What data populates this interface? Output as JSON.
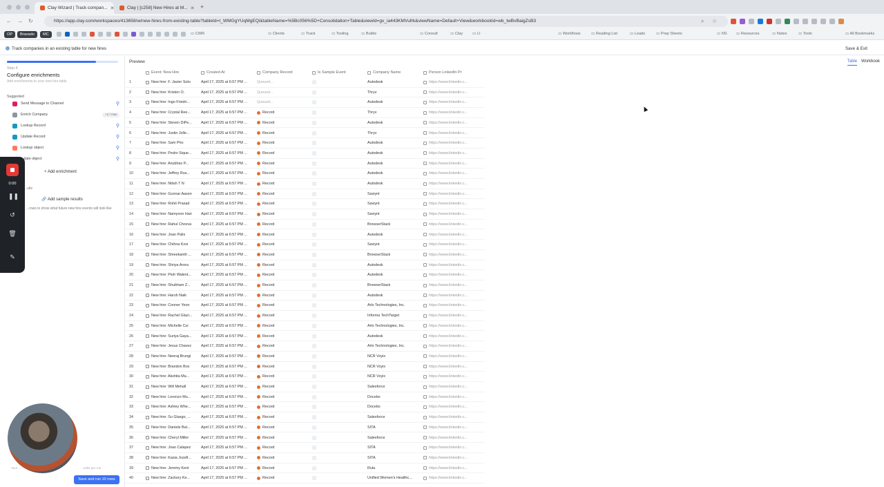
{
  "browser": {
    "tabs": [
      {
        "title": "Clay Wizard | Track compan...",
        "active": true
      },
      {
        "title": "Clay | [c258] New Hires at M...",
        "active": false
      }
    ],
    "url": "https://app.clay.com/workspaces/413658/w/new-hires-from-existing-table?tableId=t_WMGgYUqMgEQi&tableName=%5Bc056%5D+Consolidation+Table&viewId=gv_ia443KMVufrk&viewName=Default+View&workbookId=wb_twBvBaigZsB3",
    "bookmarks": [
      {
        "kind": "chip",
        "label": "OP"
      },
      {
        "kind": "chip",
        "label": "Bravado"
      },
      {
        "kind": "chip",
        "label": "MC"
      },
      {
        "kind": "folder",
        "label": "CWR"
      },
      {
        "kind": "folder",
        "label": "Clients"
      },
      {
        "kind": "folder",
        "label": "Track"
      },
      {
        "kind": "folder",
        "label": "Tooling"
      },
      {
        "kind": "folder",
        "label": "Builds"
      },
      {
        "kind": "folder",
        "label": "Consult"
      },
      {
        "kind": "folder",
        "label": "Clay"
      },
      {
        "kind": "folder",
        "label": "LI"
      },
      {
        "kind": "folder",
        "label": "Workflows"
      },
      {
        "kind": "folder",
        "label": "Reading List"
      },
      {
        "kind": "folder",
        "label": "Leads"
      },
      {
        "kind": "folder",
        "label": "Prep Sheets"
      },
      {
        "kind": "folder",
        "label": "NS"
      },
      {
        "kind": "folder",
        "label": "Resources"
      },
      {
        "kind": "folder",
        "label": "Notes"
      },
      {
        "kind": "folder",
        "label": "Tools"
      },
      {
        "kind": "folder",
        "label": "All Bookmarks"
      }
    ]
  },
  "app": {
    "title": "Track companies in an existing table for new hires",
    "save_exit": "Save & Exit"
  },
  "sidebar": {
    "progress_fraction": 0.8,
    "step": "Step 4",
    "heading": "Configure enrichments",
    "subheading": "Add enrichments to your new hire table",
    "suggested_label": "Suggested",
    "enrichments": [
      {
        "label": "Send Message to Channel",
        "icon": "slack-icon",
        "color": "#e01e5a",
        "extra": "pin"
      },
      {
        "label": "Enrich Company",
        "icon": "building-icon",
        "color": "#8c96a3",
        "extra": "badge",
        "badge": "~1 / row"
      },
      {
        "label": "Lookup Record",
        "icon": "salesforce-icon",
        "color": "#1798c1",
        "extra": "pin"
      },
      {
        "label": "Update Record",
        "icon": "salesforce-icon",
        "color": "#1798c1",
        "extra": "pin"
      },
      {
        "label": "Lookup object",
        "icon": "hubspot-icon",
        "color": "#ff7a59",
        "extra": "pin"
      },
      {
        "label": "...date object",
        "icon": "hubspot-icon",
        "color": "#ff7a59",
        "extra": "pin"
      }
    ],
    "add_enrichment": "+ Add enrichment",
    "results_label": "...ults",
    "add_sample": "Add sample results",
    "sample_hint": "...rows to show what future new hire events will look like",
    "footnote_left": "Your ...",
    "footnote_right": "...edits per run",
    "run_button": "Save and run 10 rows"
  },
  "recorder": {
    "time": "0:00"
  },
  "main": {
    "preview_label": "Preview",
    "view_tabs": {
      "table": "Table",
      "workbook": "Workbook"
    },
    "columns": {
      "event": "Event: New Hire",
      "created": "Created At",
      "record": "Company Record",
      "sample": "Is Sample Event",
      "company": "Company Name",
      "linkedin": "Person LinkedIn Pr"
    },
    "rows": [
      {
        "n": "1",
        "ev": "New hire: F. Javier Soto",
        "ct": "April 17, 2025 at 6:57 PM ...",
        "cr": "Queued...",
        "q": true,
        "cn": "Autodesk",
        "li": "https://www.linkedin.c..."
      },
      {
        "n": "2",
        "ev": "New hire: Kristen O.",
        "ct": "April 17, 2025 at 6:57 PM ...",
        "cr": "Queued...",
        "q": true,
        "cn": "Thryv",
        "li": "https://www.linkedin.c..."
      },
      {
        "n": "3",
        "ev": "New hire: Ingo Friedri...",
        "ct": "April 17, 2025 at 6:57 PM ...",
        "cr": "Queued...",
        "q": true,
        "cn": "Autodesk",
        "li": "https://www.linkedin.c..."
      },
      {
        "n": "4",
        "ev": "New hire: Crystal Ree...",
        "ct": "April 17, 2025 at 6:57 PM ...",
        "cr": "Record",
        "q": false,
        "cn": "Thryv",
        "li": "https://www.linkedin.c..."
      },
      {
        "n": "5",
        "ev": "New hire: Steven DiPe...",
        "ct": "April 17, 2025 at 6:57 PM ...",
        "cr": "Record",
        "q": false,
        "cn": "Autodesk",
        "li": "https://www.linkedin.c..."
      },
      {
        "n": "6",
        "ev": "New hire: Justin Jolle...",
        "ct": "April 17, 2025 at 6:57 PM ...",
        "cr": "Record",
        "q": false,
        "cn": "Thryv",
        "li": "https://www.linkedin.c..."
      },
      {
        "n": "7",
        "ev": "New hire: Sam Pho",
        "ct": "April 17, 2025 at 6:57 PM ...",
        "cr": "Record",
        "q": false,
        "cn": "Autodesk",
        "li": "https://www.linkedin.c..."
      },
      {
        "n": "8",
        "ev": "New hire: Pedro Sique...",
        "ct": "April 17, 2025 at 6:57 PM ...",
        "cr": "Record",
        "q": false,
        "cn": "Autodesk",
        "li": "https://www.linkedin.c..."
      },
      {
        "n": "9",
        "ev": "New hire: Anubhav P...",
        "ct": "April 17, 2025 at 6:57 PM ...",
        "cr": "Record",
        "q": false,
        "cn": "Autodesk",
        "li": "https://www.linkedin.c..."
      },
      {
        "n": "10",
        "ev": "New hire: Jeffrey Rus...",
        "ct": "April 17, 2025 at 6:57 PM ...",
        "cr": "Record",
        "q": false,
        "cn": "Autodesk",
        "li": "https://www.linkedin.c..."
      },
      {
        "n": "11",
        "ev": "New hire: Nitish T N",
        "ct": "April 17, 2025 at 6:57 PM ...",
        "cr": "Record",
        "q": false,
        "cn": "Autodesk",
        "li": "https://www.linkedin.c..."
      },
      {
        "n": "12",
        "ev": "New hire: Gunnar Aasen",
        "ct": "April 17, 2025 at 6:57 PM ...",
        "cr": "Record",
        "q": false,
        "cn": "Saviynt",
        "li": "https://www.linkedin.c..."
      },
      {
        "n": "13",
        "ev": "New hire: Rohit Prasad",
        "ct": "April 17, 2025 at 6:57 PM ...",
        "cr": "Record",
        "q": false,
        "cn": "Saviynt",
        "li": "https://www.linkedin.c..."
      },
      {
        "n": "14",
        "ev": "New hire: Namyoon Han",
        "ct": "April 17, 2025 at 6:57 PM ...",
        "cr": "Record",
        "q": false,
        "cn": "Saviynt",
        "li": "https://www.linkedin.c..."
      },
      {
        "n": "15",
        "ev": "New hire: Rahul Chovva",
        "ct": "April 17, 2025 at 6:57 PM ...",
        "cr": "Record",
        "q": false,
        "cn": "BrowserStack",
        "li": "https://www.linkedin.c..."
      },
      {
        "n": "16",
        "ev": "New hire: Joan Palis",
        "ct": "April 17, 2025 at 6:57 PM ...",
        "cr": "Record",
        "q": false,
        "cn": "Autodesk",
        "li": "https://www.linkedin.c..."
      },
      {
        "n": "17",
        "ev": "New hire: Chihna Kovi",
        "ct": "April 17, 2025 at 6:57 PM ...",
        "cr": "Record",
        "q": false,
        "cn": "Saviynt",
        "li": "https://www.linkedin.c..."
      },
      {
        "n": "18",
        "ev": "New hire: Shreekanth ...",
        "ct": "April 17, 2025 at 6:57 PM ...",
        "cr": "Record",
        "q": false,
        "cn": "BrowserStack",
        "li": "https://www.linkedin.c..."
      },
      {
        "n": "19",
        "ev": "New hire: Shriya Arora",
        "ct": "April 17, 2025 at 6:57 PM ...",
        "cr": "Record",
        "q": false,
        "cn": "Autodesk",
        "li": "https://www.linkedin.c..."
      },
      {
        "n": "20",
        "ev": "New hire: Piotr Walent...",
        "ct": "April 17, 2025 at 6:57 PM ...",
        "cr": "Record",
        "q": false,
        "cn": "Autodesk",
        "li": "https://www.linkedin.c..."
      },
      {
        "n": "21",
        "ev": "New hire: Shubham Z...",
        "ct": "April 17, 2025 at 6:57 PM ...",
        "cr": "Record",
        "q": false,
        "cn": "BrowserStack",
        "li": "https://www.linkedin.c..."
      },
      {
        "n": "22",
        "ev": "New hire: Harsh Naik",
        "ct": "April 17, 2025 at 6:57 PM ...",
        "cr": "Record",
        "q": false,
        "cn": "Autodesk",
        "li": "https://www.linkedin.c..."
      },
      {
        "n": "23",
        "ev": "New hire: Conner Yeon",
        "ct": "April 17, 2025 at 6:57 PM ...",
        "cr": "Record",
        "q": false,
        "cn": "Arlo Technologies, Inc.",
        "li": "https://www.linkedin.c..."
      },
      {
        "n": "24",
        "ev": "New hire: Rachel Glazi...",
        "ct": "April 17, 2025 at 6:57 PM ...",
        "cr": "Record",
        "q": false,
        "cn": "Informa TechTarget",
        "li": "https://www.linkedin.c..."
      },
      {
        "n": "25",
        "ev": "New hire: Michelle Cui",
        "ct": "April 17, 2025 at 6:57 PM ...",
        "cr": "Record",
        "q": false,
        "cn": "Arlo Technologies, Inc.",
        "li": "https://www.linkedin.c..."
      },
      {
        "n": "26",
        "ev": "New hire: Suriya Gaya...",
        "ct": "April 17, 2025 at 6:57 PM ...",
        "cr": "Record",
        "q": false,
        "cn": "Autodesk",
        "li": "https://www.linkedin.c..."
      },
      {
        "n": "27",
        "ev": "New hire: Jesus Chavez",
        "ct": "April 17, 2025 at 6:57 PM ...",
        "cr": "Record",
        "q": false,
        "cn": "Arlo Technologies, Inc.",
        "li": "https://www.linkedin.c..."
      },
      {
        "n": "28",
        "ev": "New hire: Neeraj Brungi",
        "ct": "April 17, 2025 at 6:57 PM ...",
        "cr": "Record",
        "q": false,
        "cn": "NCR Voyix",
        "li": "https://www.linkedin.c..."
      },
      {
        "n": "29",
        "ev": "New hire: Brandon Box",
        "ct": "April 17, 2025 at 6:57 PM ...",
        "cr": "Record",
        "q": false,
        "cn": "NCR Voyix",
        "li": "https://www.linkedin.c..."
      },
      {
        "n": "30",
        "ev": "New hire: Akshita Ma...",
        "ct": "April 17, 2025 at 6:57 PM ...",
        "cr": "Record",
        "q": false,
        "cn": "NCR Voyix",
        "li": "https://www.linkedin.c..."
      },
      {
        "n": "31",
        "ev": "New hire: Will Mehall",
        "ct": "April 17, 2025 at 6:57 PM ...",
        "cr": "Record",
        "q": false,
        "cn": "Salesforce",
        "li": "https://www.linkedin.c..."
      },
      {
        "n": "32",
        "ev": "New hire: Lorenzo Mu...",
        "ct": "April 17, 2025 at 6:57 PM ...",
        "cr": "Record",
        "q": false,
        "cn": "Docebo",
        "li": "https://www.linkedin.c..."
      },
      {
        "n": "33",
        "ev": "New hire: Ashley Whe...",
        "ct": "April 17, 2025 at 6:57 PM ...",
        "cr": "Record",
        "q": false,
        "cn": "Docebo",
        "li": "https://www.linkedin.c..."
      },
      {
        "n": "34",
        "ev": "New hire: Su Glasgo, ...",
        "ct": "April 17, 2025 at 6:57 PM ...",
        "cr": "Record",
        "q": false,
        "cn": "Salesforce",
        "li": "https://www.linkedin.c..."
      },
      {
        "n": "35",
        "ev": "New hire: Daniele Bal...",
        "ct": "April 17, 2025 at 6:57 PM ...",
        "cr": "Record",
        "q": false,
        "cn": "SITA",
        "li": "https://www.linkedin.c..."
      },
      {
        "n": "36",
        "ev": "New hire: Cheryl Miller",
        "ct": "April 17, 2025 at 6:57 PM ...",
        "cr": "Record",
        "q": false,
        "cn": "Salesforce",
        "li": "https://www.linkedin.c..."
      },
      {
        "n": "37",
        "ev": "New hire: Joao Calapez",
        "ct": "April 17, 2025 at 6:57 PM ...",
        "cr": "Record",
        "q": false,
        "cn": "SITA",
        "li": "https://www.linkedin.c..."
      },
      {
        "n": "38",
        "ev": "New hire: Kasia Jozefi...",
        "ct": "April 17, 2025 at 6:57 PM ...",
        "cr": "Record",
        "q": false,
        "cn": "SITA",
        "li": "https://www.linkedin.c..."
      },
      {
        "n": "39",
        "ev": "New hire: Jeremy Kent",
        "ct": "April 17, 2025 at 6:57 PM ...",
        "cr": "Record",
        "q": false,
        "cn": "Rula",
        "li": "https://www.linkedin.c..."
      },
      {
        "n": "40",
        "ev": "New hire: Zackery Ke...",
        "ct": "April 17, 2025 at 6:57 PM ...",
        "cr": "Record",
        "q": false,
        "cn": "Unified Women's Healthc...",
        "li": "https://www.linkedin.c..."
      }
    ]
  }
}
